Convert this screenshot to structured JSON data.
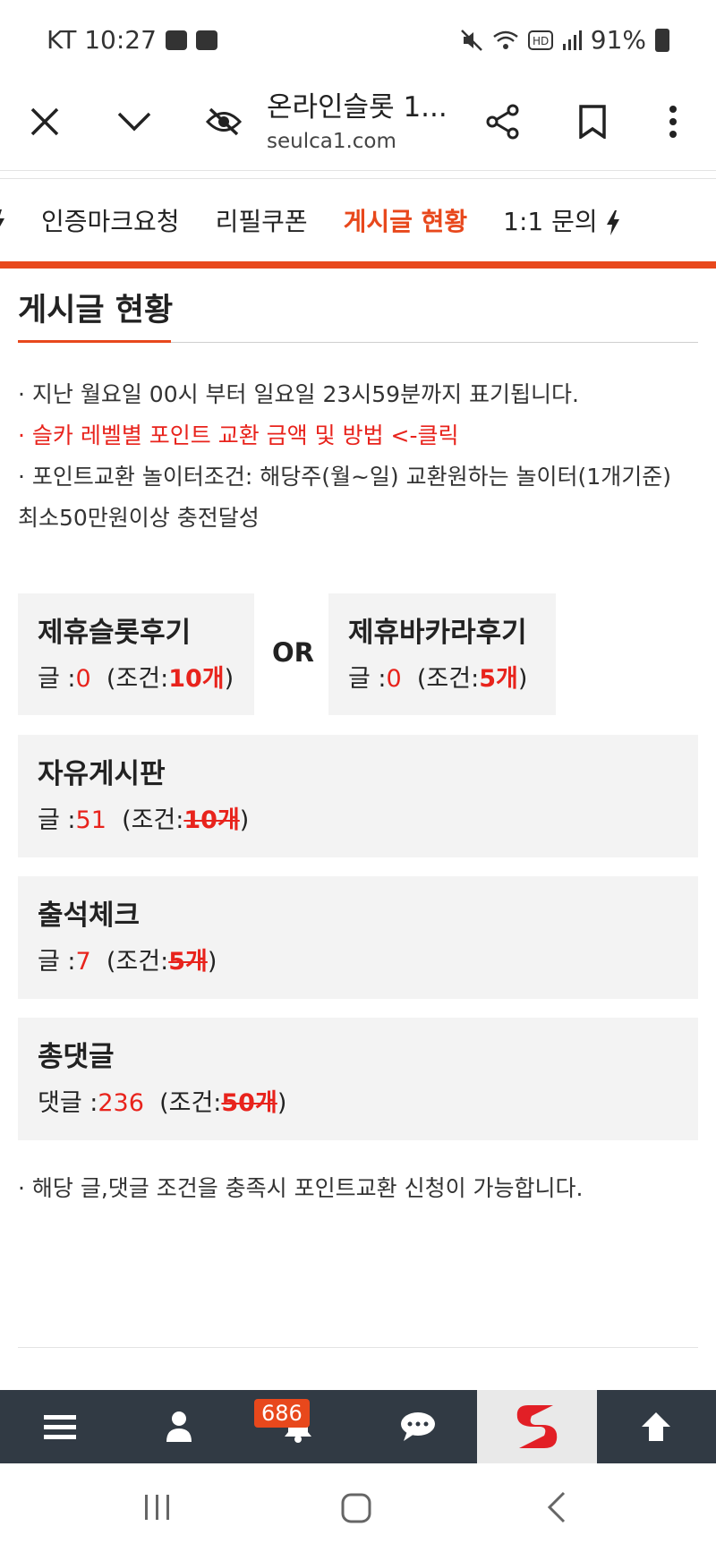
{
  "status_bar": {
    "carrier_time": "KT 10:27",
    "battery": "91%"
  },
  "browser": {
    "title": "온라인슬롯 1...",
    "url": "seulca1.com"
  },
  "tabs": [
    {
      "label": ""
    },
    {
      "label": "인증마크요청"
    },
    {
      "label": "리필쿠폰"
    },
    {
      "label": "게시글 현황"
    },
    {
      "label": "1:1 문의"
    }
  ],
  "section": {
    "title": "게시글 현황"
  },
  "notes": [
    "· 지난 월요일 00시 부터 일요일 23시59분까지 표기됩니다.",
    "· 슬카 레벨별 포인트 교환 금액 및 방법 <-클릭",
    "· 포인트교환 놀이터조건: 해당주(월~일) 교환원하는 놀이터(1개기준) 최소50만원이상 충전달성"
  ],
  "cards": {
    "slot": {
      "title": "제휴슬롯후기",
      "label": "글 :",
      "count": "0",
      "cond_prefix": "(조건:",
      "cond": "10개",
      "cond_suffix": ")"
    },
    "or": "OR",
    "baccarat": {
      "title": "제휴바카라후기",
      "label": "글 :",
      "count": "0",
      "cond_prefix": "(조건:",
      "cond": "5개",
      "cond_suffix": ")"
    },
    "free": {
      "title": "자유게시판",
      "label": "글 :",
      "count": "51",
      "cond_prefix": "(조건:",
      "cond": "10개",
      "cond_suffix": ")"
    },
    "attendance": {
      "title": "출석체크",
      "label": "글 :",
      "count": "7",
      "cond_prefix": "(조건:",
      "cond": "5개",
      "cond_suffix": ")"
    },
    "comments": {
      "title": "총댓글",
      "label": "댓글 :",
      "count": "236",
      "cond_prefix": "(조건:",
      "cond": "50개",
      "cond_suffix": ")"
    }
  },
  "footnote": "· 해당 글,댓글 조건을 충족시 포인트교환 신청이 가능합니다.",
  "appbar": {
    "notification_count": "686"
  },
  "colors": {
    "accent": "#e8481c",
    "red": "#e8231c",
    "appbar": "#313a44"
  }
}
